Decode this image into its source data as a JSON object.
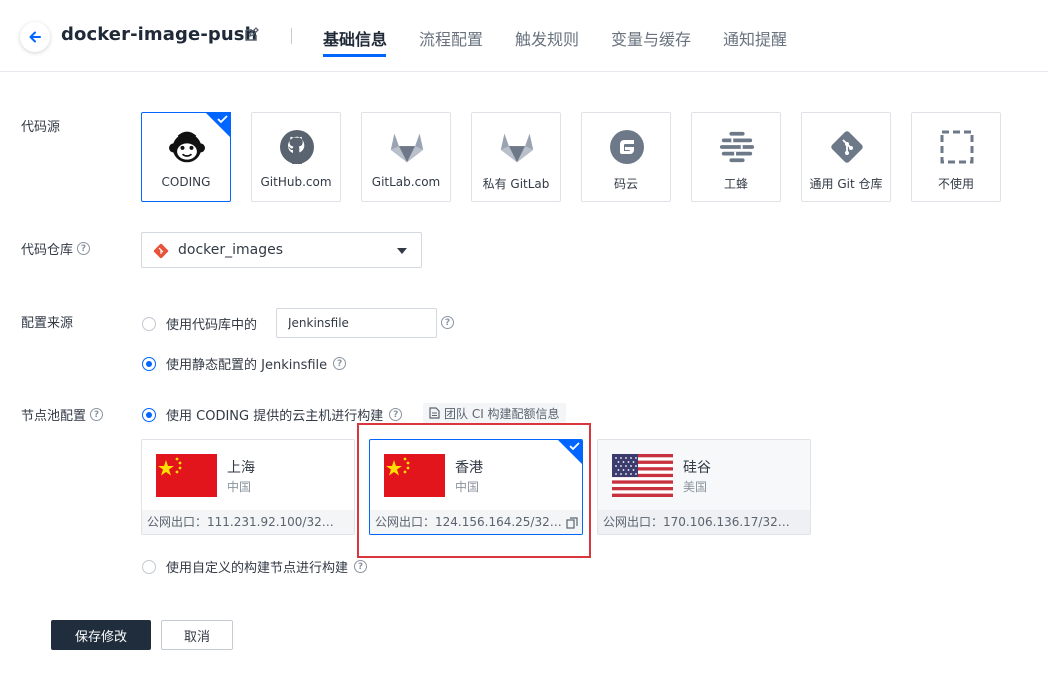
{
  "header": {
    "title": "docker-image-push",
    "tabs": [
      {
        "label": "基础信息",
        "active": true
      },
      {
        "label": "流程配置",
        "active": false
      },
      {
        "label": "触发规则",
        "active": false
      },
      {
        "label": "变量与缓存",
        "active": false
      },
      {
        "label": "通知提醒",
        "active": false
      }
    ]
  },
  "code_source": {
    "label": "代码源",
    "options": [
      {
        "label": "CODING",
        "icon": "coding-monkey-icon",
        "selected": true
      },
      {
        "label": "GitHub.com",
        "icon": "github-icon",
        "selected": false
      },
      {
        "label": "GitLab.com",
        "icon": "gitlab-icon",
        "selected": false
      },
      {
        "label": "私有 GitLab",
        "icon": "gitlab-private-icon",
        "selected": false
      },
      {
        "label": "码云",
        "icon": "gitee-icon",
        "selected": false
      },
      {
        "label": "工蜂",
        "icon": "tgit-icon",
        "selected": false
      },
      {
        "label": "通用 Git 仓库",
        "icon": "git-icon",
        "selected": false
      },
      {
        "label": "不使用",
        "icon": "none-dashed-icon",
        "selected": false
      }
    ]
  },
  "repository": {
    "label": "代码仓库",
    "value": "docker_images"
  },
  "config_source": {
    "label": "配置来源",
    "option_repo": "使用代码库中的",
    "jenkinsfile_path": "Jenkinsfile",
    "option_static": "使用静态配置的 Jenkinsfile",
    "selected": "static"
  },
  "node_pool": {
    "label": "节点池配置",
    "option_cloud": "使用 CODING 提供的云主机进行构建",
    "quota_link": "团队 CI 构建配额信息",
    "option_custom": "使用自定义的构建节点进行构建",
    "selected": "cloud",
    "nodes": [
      {
        "city": "上海",
        "country": "中国",
        "egress": "公网出口：111.231.92.100/32,...",
        "flag": "china-flag",
        "selected": false
      },
      {
        "city": "香港",
        "country": "中国",
        "egress": "公网出口：124.156.164.25/32,...",
        "flag": "china-flag",
        "selected": true
      },
      {
        "city": "硅谷",
        "country": "美国",
        "egress": "公网出口：170.106.136.17/32,...",
        "flag": "usa-flag",
        "selected": false
      }
    ]
  },
  "actions": {
    "save": "保存修改",
    "cancel": "取消"
  },
  "colors": {
    "accent": "#0066ff",
    "highlight_box": "#d9363e",
    "primary_button": "#1f2d3d"
  }
}
